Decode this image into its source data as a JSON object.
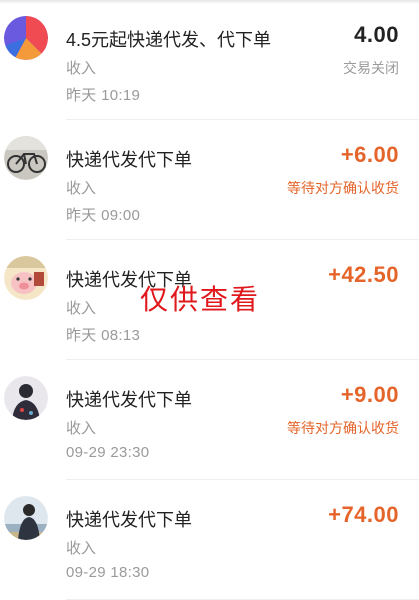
{
  "watermark": "仅供查看",
  "transactions": [
    {
      "title": "4.5元起快递代发、代下单",
      "type": "收入",
      "time": "昨天  10:19",
      "amount": "4.00",
      "status": "交易关闭",
      "avatar_icon": "multicolor-logo-icon",
      "amount_color": "#222222",
      "status_color": "#9a9a9a"
    },
    {
      "title": "快递代发代下单",
      "type": "收入",
      "time": "昨天  09:00",
      "amount": "+6.00",
      "status": "等待对方确认收货",
      "avatar_icon": "bicycle-photo-avatar",
      "amount_color": "#e5642a",
      "status_color": "#e5642a"
    },
    {
      "title": "快递代发代下单",
      "type": "收入",
      "time": "昨天  08:13",
      "amount": "+42.50",
      "status": "",
      "avatar_icon": "pig-cartoon-avatar",
      "amount_color": "#e5642a",
      "status_color": "#e5642a"
    },
    {
      "title": "快递代发代下单",
      "type": "收入",
      "time": "09-29  23:30",
      "amount": "+9.00",
      "status": "等待对方确认收货",
      "avatar_icon": "person-photo-avatar",
      "amount_color": "#e5642a",
      "status_color": "#e5642a"
    },
    {
      "title": "快递代发代下单",
      "type": "收入",
      "time": "09-29  18:30",
      "amount": "+74.00",
      "status": "",
      "avatar_icon": "person-seaside-avatar",
      "amount_color": "#e5642a",
      "status_color": "#e5642a"
    }
  ]
}
